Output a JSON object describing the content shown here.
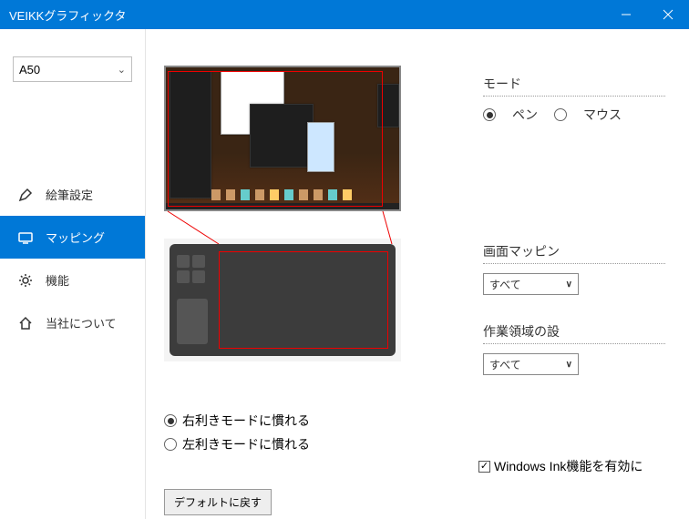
{
  "window": {
    "title": "VEIKKグラフィックタ"
  },
  "device": {
    "selected": "A50"
  },
  "sidebar": {
    "items": [
      {
        "label": "絵筆設定"
      },
      {
        "label": "マッピング"
      },
      {
        "label": "機能"
      },
      {
        "label": "当社について"
      }
    ]
  },
  "mode": {
    "label": "モード",
    "pen": "ペン",
    "mouse": "マウス",
    "selected": "pen"
  },
  "screen_mapping": {
    "label": "画面マッピン",
    "value": "すべて"
  },
  "work_area": {
    "label": "作業領域の設",
    "value": "すべて"
  },
  "handedness": {
    "right": "右利きモードに慣れる",
    "left": "左利きモードに慣れる",
    "selected": "right"
  },
  "windows_ink": {
    "label": "Windows Ink機能を有効に",
    "checked": true
  },
  "buttons": {
    "reset": "デフォルトに戻す"
  }
}
